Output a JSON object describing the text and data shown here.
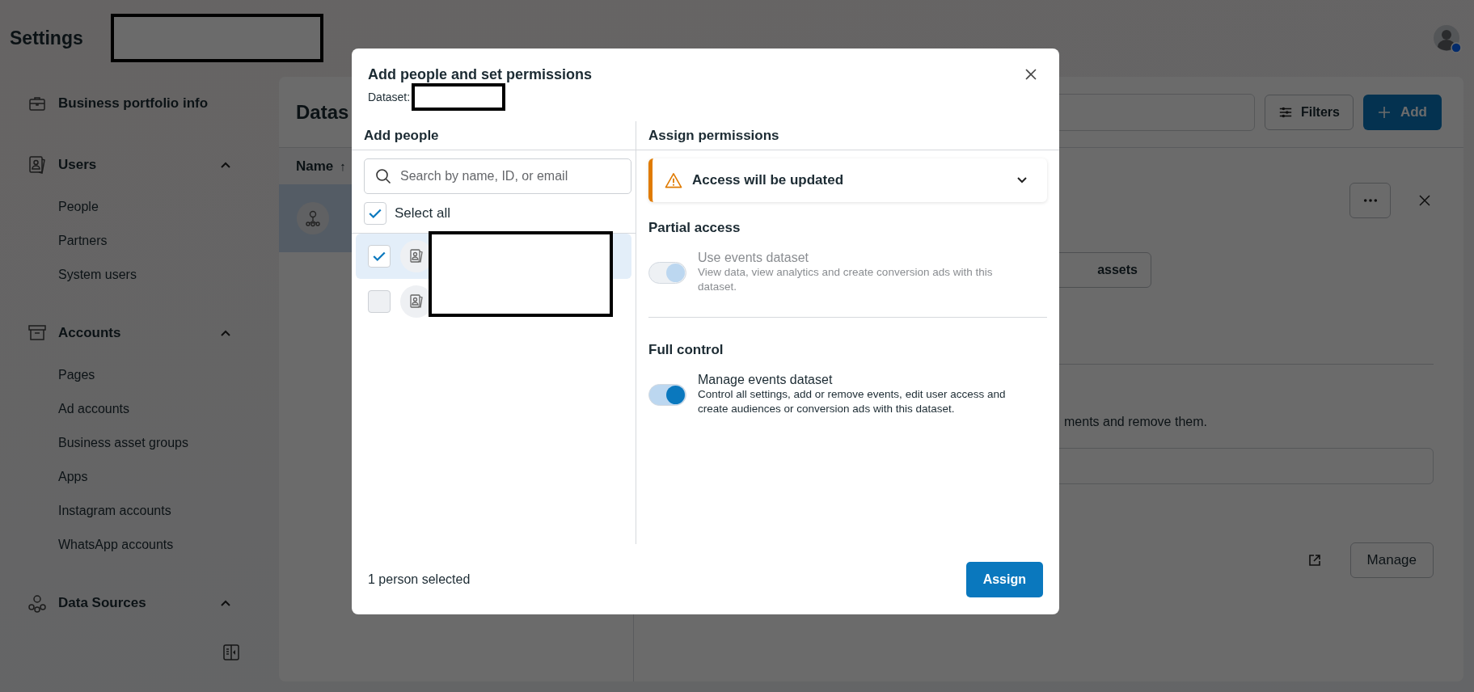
{
  "header": {
    "title": "Settings"
  },
  "sidebar": {
    "sections": [
      {
        "label": "Business portfolio info",
        "kind": "portfolio"
      },
      {
        "label": "Users",
        "kind": "users",
        "expanded": true,
        "items": [
          "People",
          "Partners",
          "System users"
        ]
      },
      {
        "label": "Accounts",
        "kind": "accounts",
        "expanded": true,
        "items": [
          "Pages",
          "Ad accounts",
          "Business asset groups",
          "Apps",
          "Instagram accounts",
          "WhatsApp accounts"
        ]
      },
      {
        "label": "Data Sources",
        "kind": "sources",
        "expanded": true
      }
    ]
  },
  "main": {
    "heading": "Datas",
    "filters_button": "Filters",
    "add_button": "Add",
    "table": {
      "columns": [
        {
          "label": "Name",
          "sort_arrow": "↑"
        }
      ],
      "rows": [
        {
          "selected": true
        }
      ]
    },
    "details": {
      "assets_button": "assets",
      "description": "ments and remove them.",
      "manage_button": "Manage"
    }
  },
  "modal": {
    "title": "Add people and set permissions",
    "dataset_label": "Dataset:",
    "add_people": {
      "heading": "Add people",
      "search": {
        "placeholder": "Search by name, ID, or email"
      },
      "select_all": {
        "label": "Select all",
        "checked": true
      },
      "people": [
        {
          "checked": true,
          "selected": true
        },
        {
          "checked": false,
          "selected": false
        }
      ]
    },
    "permissions": {
      "heading": "Assign permissions",
      "alert": {
        "title": "Access will be updated",
        "expanded": false
      },
      "groups": [
        {
          "title": "Partial access",
          "options": [
            {
              "label": "Use events dataset",
              "description": "View data, view analytics and create conversion ads with this dataset.",
              "on": true,
              "disabled": true
            }
          ]
        },
        {
          "title": "Full control",
          "options": [
            {
              "label": "Manage events dataset",
              "description": "Control all settings, add or remove events, edit user access and create audiences or conversion ads with this dataset.",
              "on": true,
              "disabled": false
            }
          ]
        }
      ]
    },
    "footer": {
      "status": "1 person selected",
      "assign_button": "Assign"
    }
  }
}
